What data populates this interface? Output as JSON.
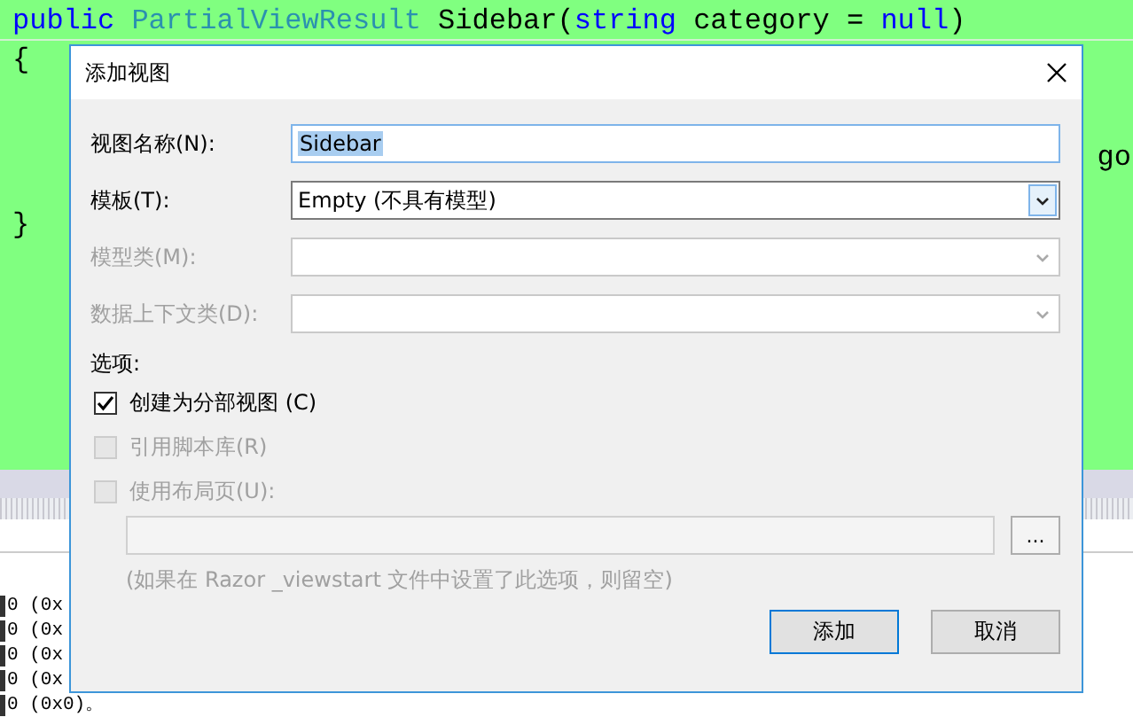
{
  "editor": {
    "code_lines": [
      {
        "kind": "line",
        "tokens": [
          {
            "kind": "keyword",
            "text": "public"
          },
          {
            "kind": "type",
            "text": "PartialViewResult",
            "space_before": true
          },
          {
            "kind": "plain",
            "text": " Sidebar("
          },
          {
            "kind": "keyword",
            "text": "string"
          },
          {
            "kind": "plain",
            "text": " category = "
          },
          {
            "kind": "keyword",
            "text": "null"
          },
          {
            "kind": "plain",
            "text": ")"
          }
        ]
      },
      {
        "kind": "line",
        "tokens": [
          {
            "kind": "plain",
            "text": "{"
          }
        ]
      },
      {
        "kind": "tail",
        "tokens": [
          {
            "kind": "plain",
            "text": "go"
          }
        ]
      },
      {
        "kind": "line",
        "tokens": [
          {
            "kind": "plain",
            "text": "}"
          }
        ]
      }
    ]
  },
  "output": {
    "lines": [
      "0 (0x",
      "0 (0x",
      "0 (0x",
      "0 (0x",
      "0 (0x0)。"
    ]
  },
  "dialog": {
    "title": "添加视图",
    "fields": [
      {
        "kind": "text",
        "label": "视图名称(N):",
        "value": "Sidebar",
        "disabled": false
      },
      {
        "kind": "combo",
        "label": "模板(T):",
        "value": "Empty (不具有模型)",
        "disabled": false
      },
      {
        "kind": "combo",
        "label": "模型类(M):",
        "disabled": true
      },
      {
        "kind": "combo",
        "label": "数据上下文类(D):",
        "disabled": true
      }
    ],
    "options_label": "选项:",
    "checkboxes": [
      {
        "label": "创建为分部视图 (C)",
        "checked": true,
        "disabled": false
      },
      {
        "label": "引用脚本库(R)",
        "checked": false,
        "disabled": true
      },
      {
        "label": "使用布局页(U):",
        "checked": false,
        "disabled": true
      }
    ],
    "layout_browse": "...",
    "hint": "(如果在 Razor _viewstart 文件中设置了此选项，则留空)",
    "buttons": [
      {
        "label": "添加",
        "default": true
      },
      {
        "label": "取消",
        "default": false
      }
    ]
  }
}
